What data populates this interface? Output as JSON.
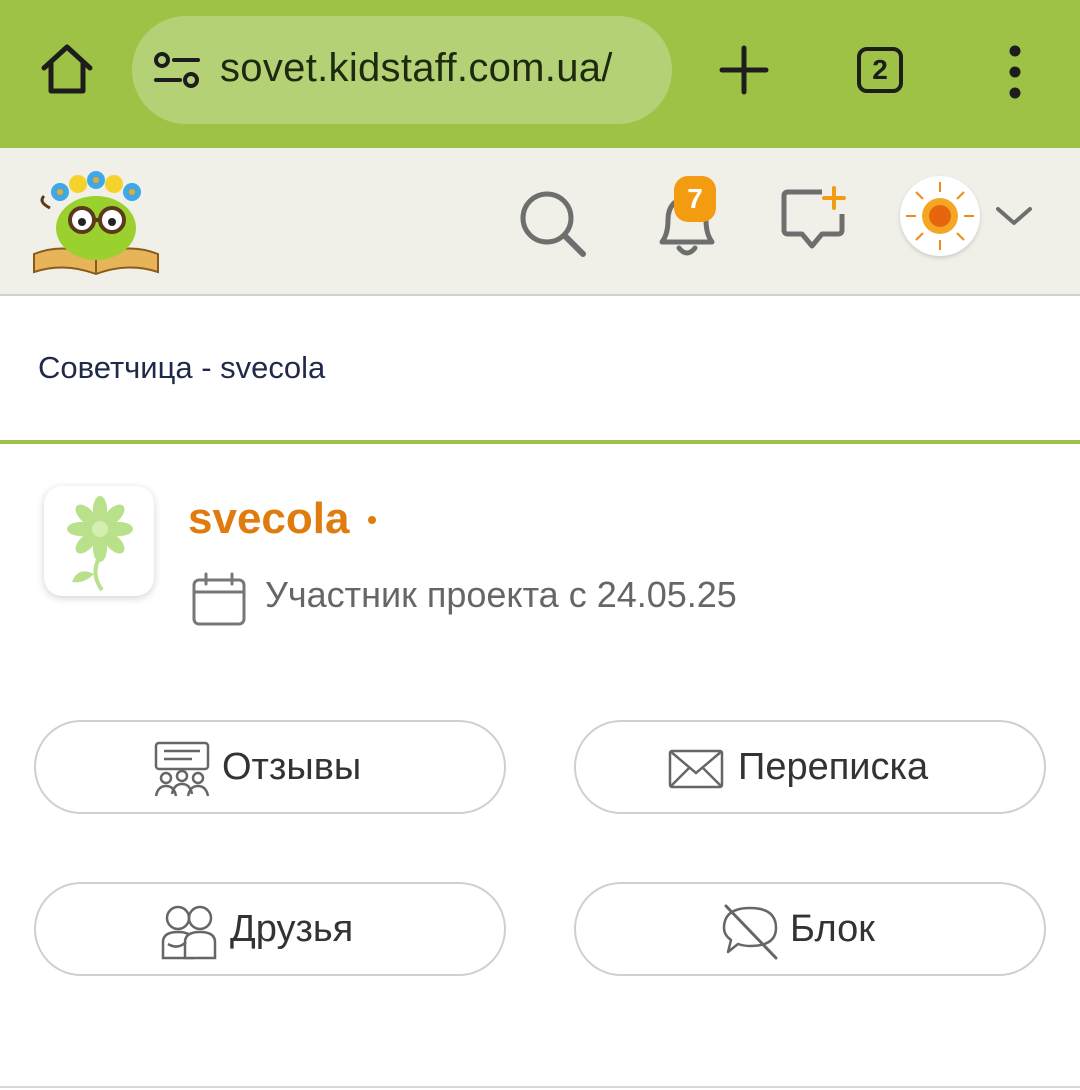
{
  "browser": {
    "url": "sovet.kidstaff.com.ua/",
    "tab_count": "2",
    "icons": [
      "home-icon",
      "site-settings-icon",
      "new-tab-plus-icon",
      "tabs-icon",
      "more-vert-icon"
    ]
  },
  "header": {
    "notification_count": "7",
    "icons": [
      "search-icon",
      "bell-icon",
      "new-message-icon",
      "chevron-down-icon"
    ]
  },
  "breadcrumb": {
    "text": "Советчица - svecola"
  },
  "profile": {
    "username": "svecola",
    "member_since": "Участник проекта с 24.05.25"
  },
  "actions": {
    "reviews": "Отзывы",
    "messages": "Переписка",
    "friends": "Друзья",
    "block": "Блок"
  },
  "colors": {
    "browser_bar": "#9dc246",
    "url_pill": "#b4d275",
    "header_bg": "#f1f0e8",
    "accent_green": "#9dc246",
    "username_orange": "#e07b10",
    "badge_orange": "#f39c12"
  }
}
